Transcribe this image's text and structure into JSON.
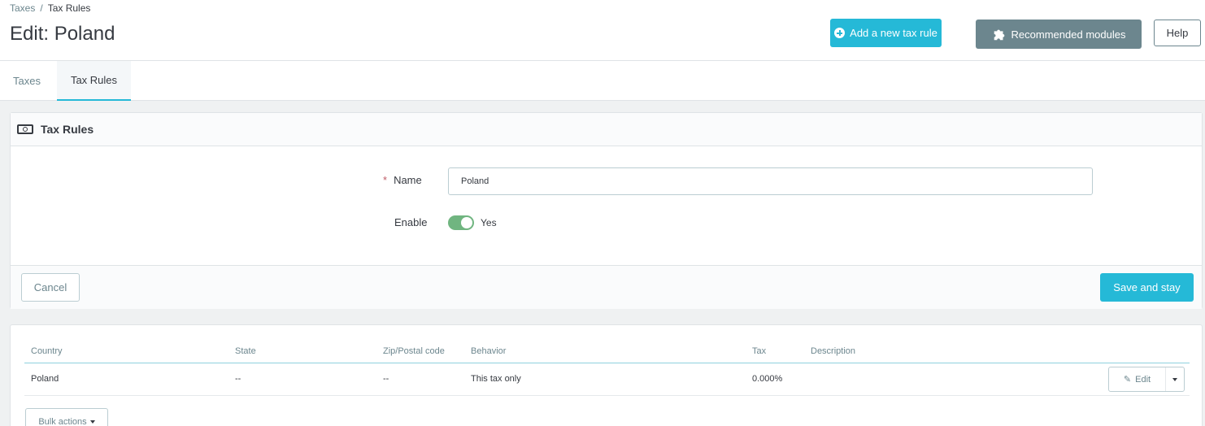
{
  "breadcrumb": {
    "parent": "Taxes",
    "separator": "/",
    "current": "Tax Rules"
  },
  "page_title": "Edit: Poland",
  "toolbar": {
    "add_label": "Add a new tax rule",
    "recommended_label": "Recommended modules",
    "help_label": "Help"
  },
  "tabs": [
    {
      "label": "Taxes"
    },
    {
      "label": "Tax Rules"
    }
  ],
  "form": {
    "title": "Tax Rules",
    "required_mark": "*",
    "name_label": "Name",
    "name_value": "Poland",
    "enable_label": "Enable",
    "enable_value": "Yes",
    "cancel_label": "Cancel",
    "save_label": "Save and stay"
  },
  "table": {
    "columns": [
      "Country",
      "State",
      "Zip/Postal code",
      "Behavior",
      "Tax",
      "Description"
    ],
    "rows": [
      {
        "country": "Poland",
        "state": "--",
        "zip": "--",
        "behavior": "This tax only",
        "tax": "0.000%",
        "description": ""
      }
    ],
    "edit_label": "Edit",
    "bulk_label": "Bulk actions"
  },
  "colors": {
    "accent": "#25b9d7",
    "secondary": "#6c868e",
    "toggle_on": "#70b580"
  }
}
